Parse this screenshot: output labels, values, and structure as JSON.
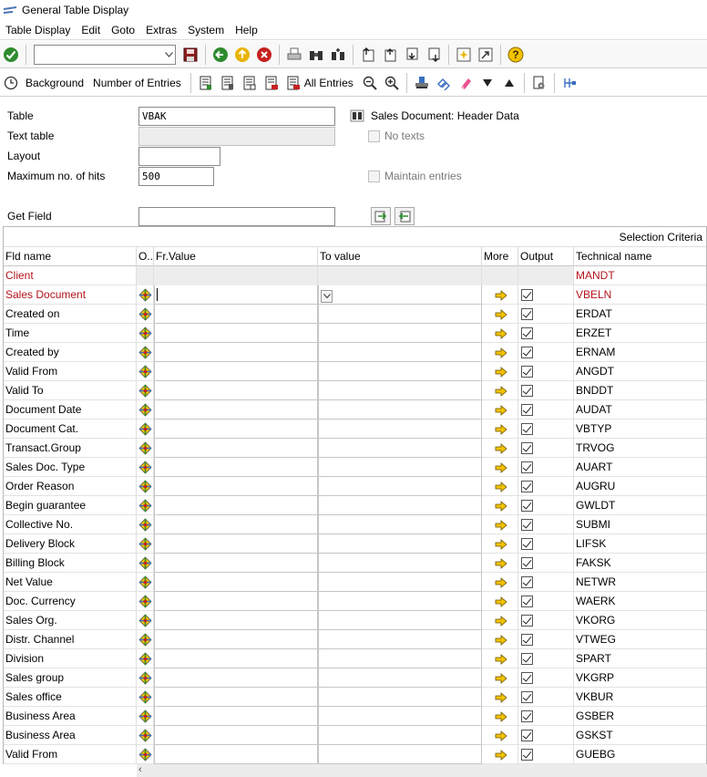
{
  "window": {
    "title": "General Table Display"
  },
  "menu": [
    "Table Display",
    "Edit",
    "Goto",
    "Extras",
    "System",
    "Help"
  ],
  "toolbar2": {
    "background_label": "Background",
    "entries_label": "Number of Entries",
    "all_entries_label": "All Entries"
  },
  "form": {
    "table_label": "Table",
    "table_value": "VBAK",
    "table_desc": "Sales Document: Header Data",
    "text_table_label": "Text table",
    "no_texts_label": "No texts",
    "layout_label": "Layout",
    "layout_value": "",
    "max_hits_label": "Maximum no. of hits",
    "max_hits_value": "500",
    "maintain_label": "Maintain entries",
    "get_field_label": "Get Field",
    "get_field_value": ""
  },
  "grid": {
    "selection_criteria": "Selection Criteria",
    "headers": {
      "fld": "Fld name",
      "op": "O..",
      "from": "Fr.Value",
      "to": "To value",
      "more": "More",
      "output": "Output",
      "tech": "Technical name"
    },
    "rows": [
      {
        "name": "Client",
        "tech": "MANDT",
        "key": true,
        "gray": true
      },
      {
        "name": "Sales Document",
        "tech": "VBELN",
        "key": true,
        "gray": false
      },
      {
        "name": "Created on",
        "tech": "ERDAT"
      },
      {
        "name": "Time",
        "tech": "ERZET"
      },
      {
        "name": "Created by",
        "tech": "ERNAM"
      },
      {
        "name": "Valid From",
        "tech": "ANGDT"
      },
      {
        "name": "Valid To",
        "tech": "BNDDT"
      },
      {
        "name": "Document Date",
        "tech": "AUDAT"
      },
      {
        "name": "Document Cat.",
        "tech": "VBTYP"
      },
      {
        "name": "Transact.Group",
        "tech": "TRVOG"
      },
      {
        "name": "Sales Doc. Type",
        "tech": "AUART"
      },
      {
        "name": "Order Reason",
        "tech": "AUGRU"
      },
      {
        "name": "Begin guarantee",
        "tech": "GWLDT"
      },
      {
        "name": "Collective No.",
        "tech": "SUBMI"
      },
      {
        "name": "Delivery Block",
        "tech": "LIFSK"
      },
      {
        "name": "Billing Block",
        "tech": "FAKSK"
      },
      {
        "name": "Net Value",
        "tech": "NETWR"
      },
      {
        "name": "Doc. Currency",
        "tech": "WAERK"
      },
      {
        "name": "Sales Org.",
        "tech": "VKORG"
      },
      {
        "name": "Distr. Channel",
        "tech": "VTWEG"
      },
      {
        "name": "Division",
        "tech": "SPART"
      },
      {
        "name": "Sales group",
        "tech": "VKGRP"
      },
      {
        "name": "Sales office",
        "tech": "VKBUR"
      },
      {
        "name": "Business Area",
        "tech": "GSBER"
      },
      {
        "name": "Business Area",
        "tech": "GSKST"
      },
      {
        "name": "Valid From",
        "tech": "GUEBG"
      }
    ]
  },
  "colors": {
    "key_red": "#b3131b",
    "accent_yellow": "#f2c200",
    "check_green": "#2e8b2e"
  }
}
